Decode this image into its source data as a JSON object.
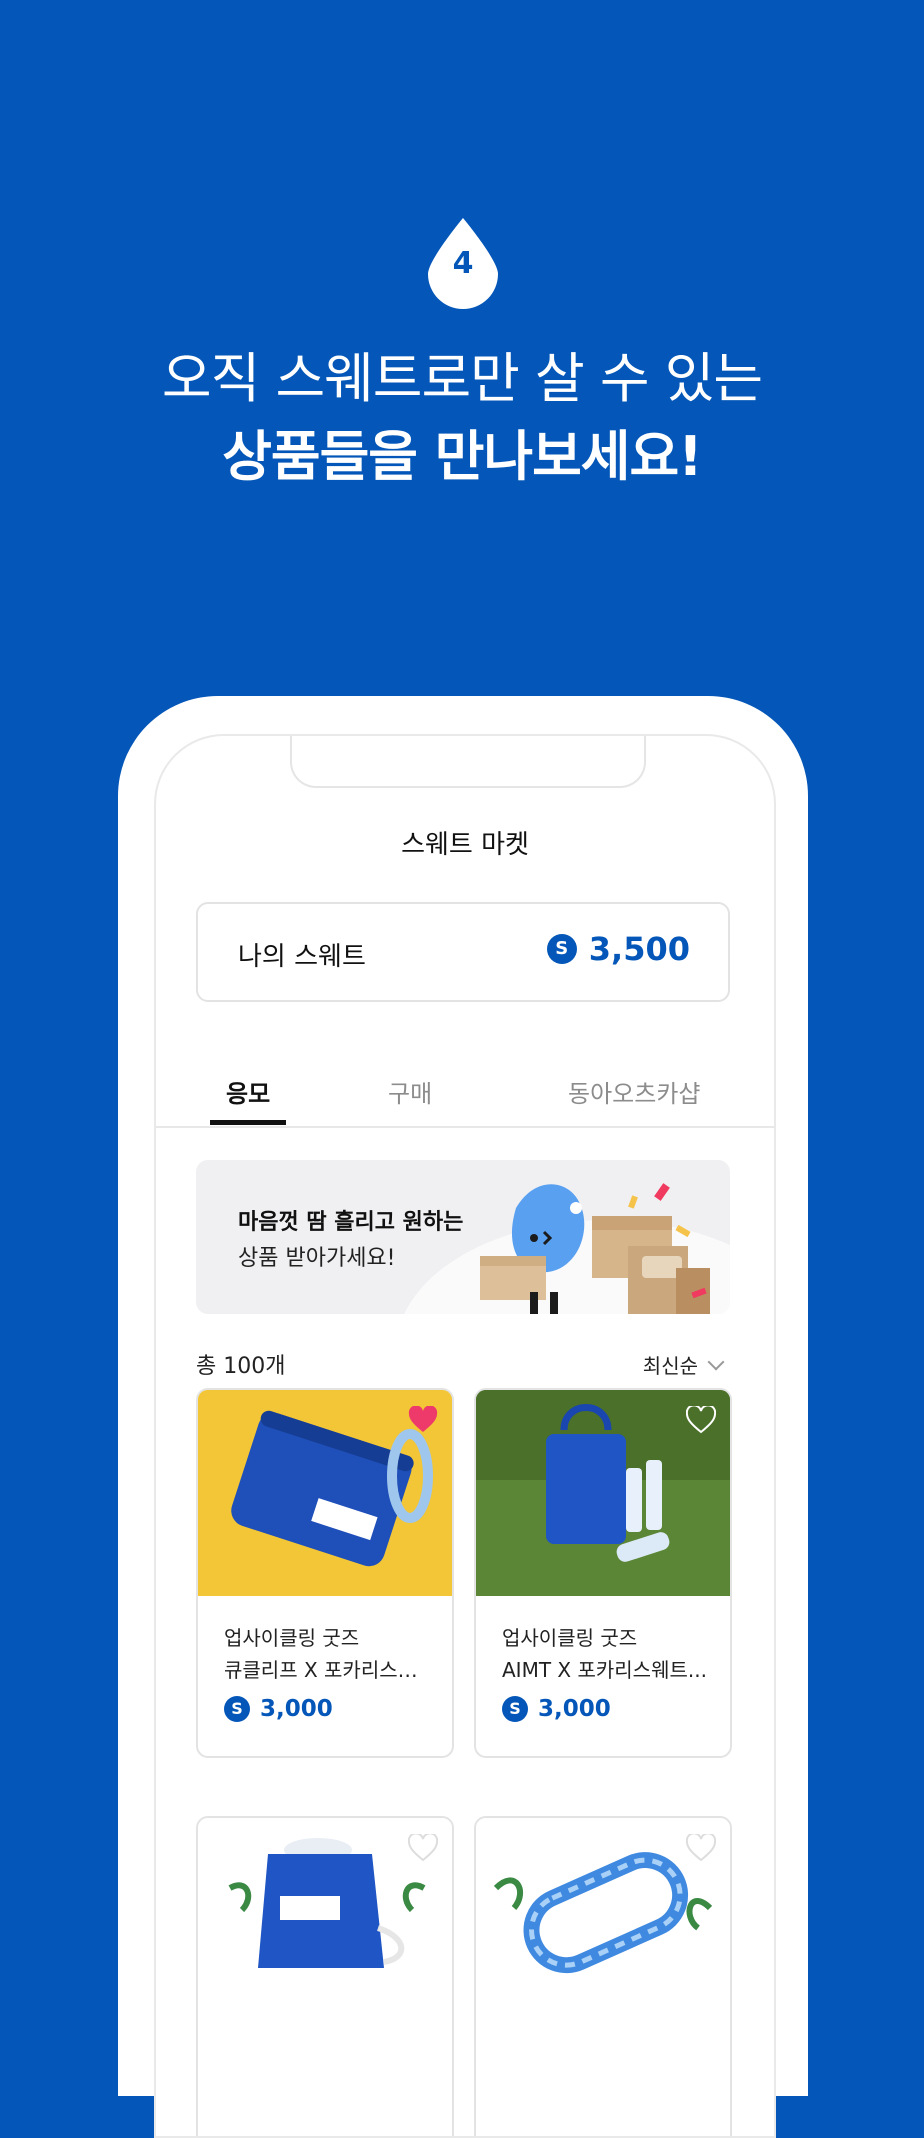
{
  "step": {
    "number": "4"
  },
  "headline": {
    "line1": "오직 스웨트로만 살 수 있는",
    "line2": "상품들을 만나보세요!"
  },
  "app": {
    "title": "스웨트 마켓",
    "wallet": {
      "label": "나의 스웨트",
      "coin_symbol": "S",
      "balance": "3,500"
    },
    "tabs": [
      {
        "label": "응모",
        "active": true
      },
      {
        "label": "구매",
        "active": false
      },
      {
        "label": "동아오츠카샵",
        "active": false
      }
    ],
    "banner": {
      "line1": "마음껏 땀 흘리고 원하는",
      "line2": "상품 받아가세요!"
    },
    "list": {
      "count": "총 100개",
      "sort": "최신순"
    },
    "products": [
      {
        "line1": "업사이클링 굿즈",
        "line2": "큐클리프 X 포카리스웨...",
        "price": "3,000",
        "liked": true
      },
      {
        "line1": "업사이클링 굿즈",
        "line2": "AIMT X 포카리스웨트...",
        "price": "3,000",
        "liked": false
      },
      {
        "line1": "",
        "line2": "",
        "price": "",
        "liked": false
      },
      {
        "line1": "",
        "line2": "",
        "price": "",
        "liked": false
      }
    ]
  },
  "colors": {
    "brand_blue": "#0457b8",
    "heart_pink": "#ee3a6a"
  }
}
